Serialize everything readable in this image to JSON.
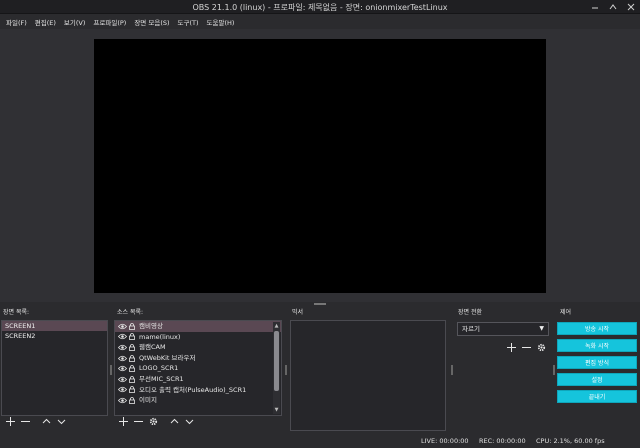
{
  "window": {
    "title": "OBS 21.1.0 (linux) - 프로파일: 제목없음 - 장면: onionmixerTestLinux"
  },
  "menu": [
    {
      "label": "파일(F)"
    },
    {
      "label": "편집(E)"
    },
    {
      "label": "보기(V)"
    },
    {
      "label": "프로파일(P)"
    },
    {
      "label": "장면 모음(S)"
    },
    {
      "label": "도구(T)"
    },
    {
      "label": "도움말(H)"
    }
  ],
  "scenes": {
    "title": "장면 목록:",
    "items": [
      {
        "label": "SCREEN1",
        "selected": true
      },
      {
        "label": "SCREEN2",
        "selected": false
      }
    ]
  },
  "sources": {
    "title": "소스 목록:",
    "items": [
      {
        "label": "캠비영상",
        "selected": true
      },
      {
        "label": "mame(linux)",
        "selected": false
      },
      {
        "label": "웹캠CAM",
        "selected": false
      },
      {
        "label": "QtWebKit 브라우저",
        "selected": false
      },
      {
        "label": "LOGO_SCR1",
        "selected": false
      },
      {
        "label": "무선MIC_SCR1",
        "selected": false
      },
      {
        "label": "오디오 출력 캡처(PulseAudio)_SCR1",
        "selected": false
      },
      {
        "label": "이미지",
        "selected": false
      }
    ]
  },
  "mixer": {
    "title": "믹서"
  },
  "transitions": {
    "title": "장면 전환",
    "selected": "자르기"
  },
  "controls": {
    "title": "제어",
    "buttons": [
      {
        "label": "방송 시작"
      },
      {
        "label": "녹화 시작"
      },
      {
        "label": "편집 방식"
      },
      {
        "label": "설정"
      },
      {
        "label": "끝내기"
      }
    ]
  },
  "status": {
    "live": "LIVE: 00:00:00",
    "rec": "REC: 00:00:00",
    "cpu": "CPU: 2.1%, 60.00 fps"
  },
  "colors": {
    "accent": "#15c4dc",
    "selection": "#5a4853",
    "background": "#2b2b2e"
  }
}
